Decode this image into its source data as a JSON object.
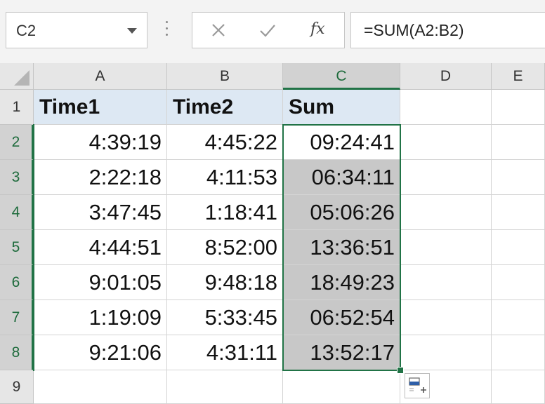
{
  "formula_bar": {
    "name_box": "C2",
    "formula": "=SUM(A2:B2)",
    "fx_label": "fx",
    "icons": {
      "cancel": "close-icon",
      "enter": "check-icon",
      "insert_function": "fx-icon",
      "name_box_dropdown": "chevron-down-icon",
      "splitter": "vertical-dots-icon"
    }
  },
  "columns": [
    "A",
    "B",
    "C",
    "D",
    "E"
  ],
  "selected_column": "C",
  "rows": [
    "1",
    "2",
    "3",
    "4",
    "5",
    "6",
    "7",
    "8",
    "9"
  ],
  "selected_rows": [
    "2",
    "3",
    "4",
    "5",
    "6",
    "7",
    "8"
  ],
  "header_row": [
    "Time1",
    "Time2",
    "Sum"
  ],
  "data_rows": [
    [
      "4:39:19",
      "4:45:22",
      "09:24:41"
    ],
    [
      "2:22:18",
      "4:11:53",
      "06:34:11"
    ],
    [
      "3:47:45",
      "1:18:41",
      "05:06:26"
    ],
    [
      "4:44:51",
      "8:52:00",
      "13:36:51"
    ],
    [
      "9:01:05",
      "9:48:18",
      "18:49:23"
    ],
    [
      "1:19:09",
      "5:33:45",
      "06:52:54"
    ],
    [
      "9:21:06",
      "4:31:11",
      "13:52:17"
    ]
  ],
  "colors": {
    "accent": "#217346",
    "header_fill": "#dde8f3",
    "selection_fill": "#c8c8c8"
  },
  "quick_analysis_icon": "quick-analysis-icon"
}
